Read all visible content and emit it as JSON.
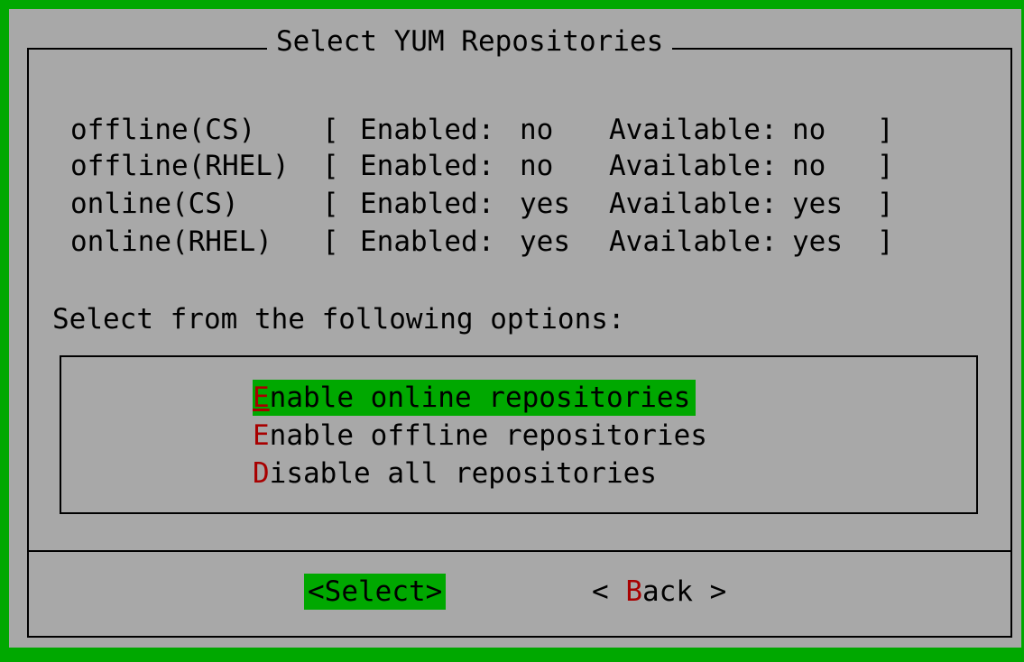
{
  "dialog": {
    "title": "Select YUM Repositories"
  },
  "repositories": [
    {
      "name": "offline(CS)",
      "enabled_label": "Enabled:",
      "enabled": "no",
      "available_label": "Available:",
      "available": "no"
    },
    {
      "name": "offline(RHEL)",
      "enabled_label": "Enabled:",
      "enabled": "no",
      "available_label": "Available:",
      "available": "no"
    },
    {
      "name": "online(CS)",
      "enabled_label": "Enabled:",
      "enabled": "yes",
      "available_label": "Available:",
      "available": "yes"
    },
    {
      "name": "online(RHEL)",
      "enabled_label": "Enabled:",
      "enabled": "yes",
      "available_label": "Available:",
      "available": "yes"
    }
  ],
  "brackets": {
    "open": "[",
    "close": "]"
  },
  "prompt": "Select from the following options:",
  "menu": [
    {
      "hotkey": "E",
      "rest": "nable online repositories",
      "selected": true
    },
    {
      "hotkey": "E",
      "rest": "nable offline repositories",
      "selected": false
    },
    {
      "hotkey": "D",
      "rest": "isable all repositories",
      "selected": false
    }
  ],
  "buttons": {
    "select": {
      "label": "<Select>",
      "selected": true
    },
    "back": {
      "prefix": "< ",
      "hotkey": "B",
      "rest": "ack >",
      "selected": false
    }
  },
  "colors": {
    "screen_background": "#00a800",
    "dialog_background": "#a8a8a8",
    "highlight": "#00a800",
    "hotkey": "#a80000",
    "text": "#000000"
  }
}
